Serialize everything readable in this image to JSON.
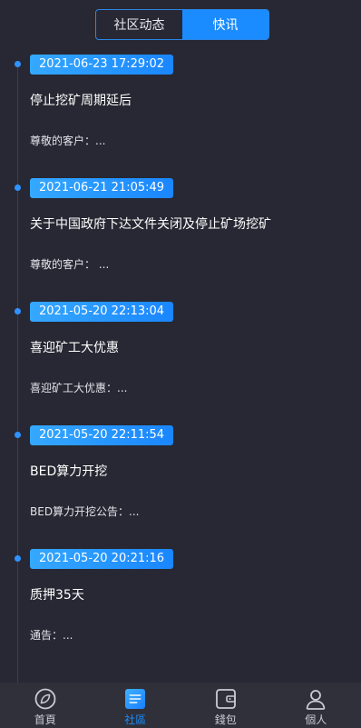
{
  "tabs": [
    {
      "label": "社区动态",
      "active": false
    },
    {
      "label": "快讯",
      "active": true
    }
  ],
  "news": [
    {
      "date": "2021-06-23 17:29:02",
      "title": "停止挖矿周期延后",
      "excerpt": "尊敬的客户：..."
    },
    {
      "date": "2021-06-21 21:05:49",
      "title": "关于中国政府下达文件关闭及停止矿场挖矿",
      "excerpt": "尊敬的客户： ..."
    },
    {
      "date": "2021-05-20 22:13:04",
      "title": "喜迎矿工大优惠",
      "excerpt": "喜迎矿工大优惠：..."
    },
    {
      "date": "2021-05-20 22:11:54",
      "title": "BED算力开挖",
      "excerpt": "BED算力开挖公告：..."
    },
    {
      "date": "2021-05-20 20:21:16",
      "title": "质押35天",
      "excerpt": "通告：..."
    }
  ],
  "bottom_nav": [
    {
      "label": "首頁",
      "icon": "home-icon",
      "active": false
    },
    {
      "label": "社區",
      "icon": "community-icon",
      "active": true
    },
    {
      "label": "錢包",
      "icon": "wallet-icon",
      "active": false
    },
    {
      "label": "個人",
      "icon": "profile-icon",
      "active": false
    }
  ],
  "colors": {
    "background": "#272833",
    "accent": "#1a8cff",
    "nav_background": "#2f3039"
  }
}
